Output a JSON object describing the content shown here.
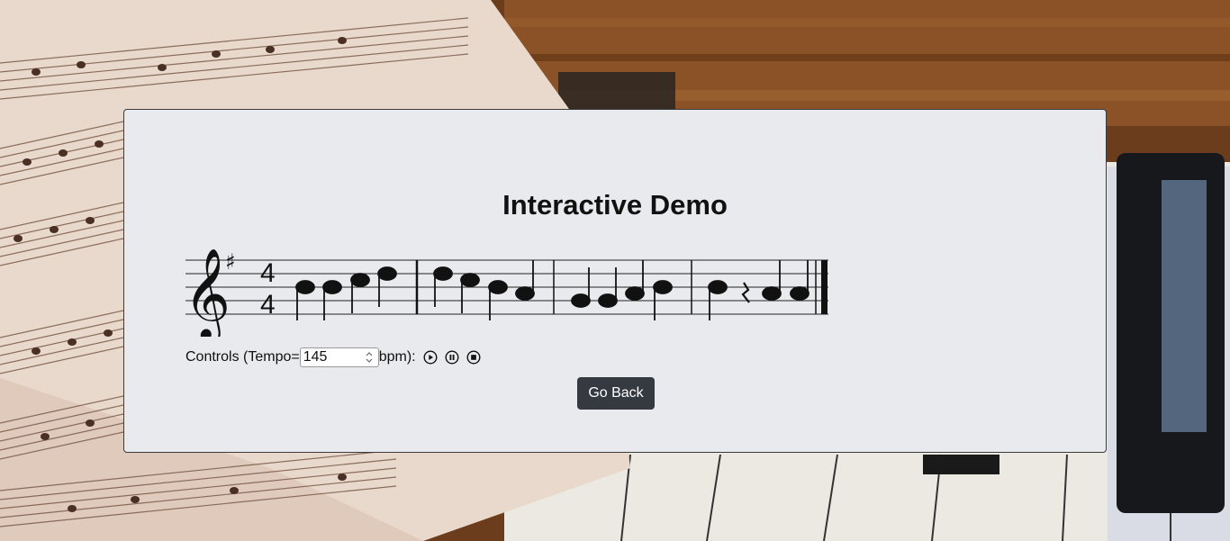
{
  "page": {
    "title": "Interactive Demo"
  },
  "score": {
    "time_signature_top": "4",
    "time_signature_bottom": "4",
    "key_signature": "♯"
  },
  "controls": {
    "label_prefix": "Controls (Tempo=",
    "tempo_value": "145",
    "label_suffix": "bpm):",
    "play_icon": "play-icon",
    "pause_icon": "pause-icon",
    "stop_icon": "stop-icon"
  },
  "actions": {
    "go_back_label": "Go Back"
  },
  "colors": {
    "card_bg": "#e8eaed",
    "button_bg": "#343a40",
    "button_text": "#ffffff"
  }
}
